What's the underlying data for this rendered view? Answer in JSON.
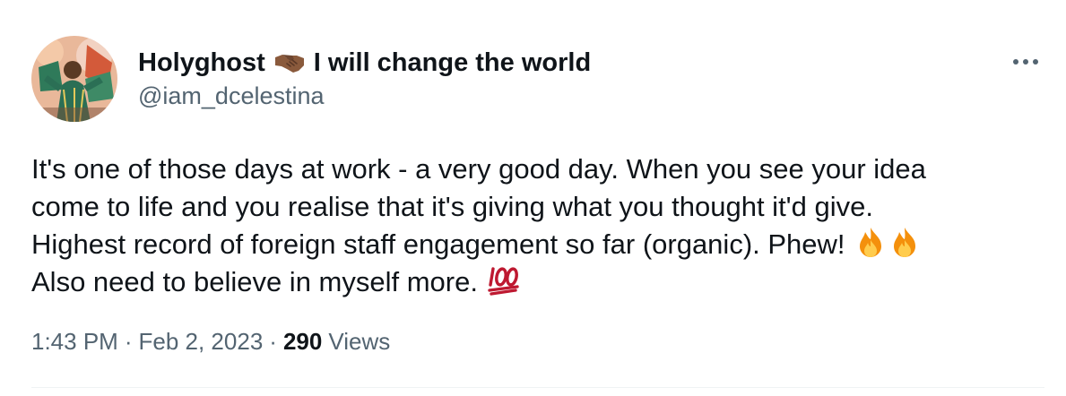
{
  "author": {
    "display_name": "Holyghost",
    "display_name_suffix": "I will change the world",
    "name_emoji": "handshake-icon",
    "handle": "@iam_dcelestina"
  },
  "tweet": {
    "lines": [
      "It's one of those days at work - a very good day. When you see your idea",
      "come to life and you realise that it's giving what you thought it'd give.",
      "Highest record of foreign staff engagement so far (organic). Phew!",
      "Also need to believe in myself more."
    ],
    "line3_emojis": [
      "fire-icon",
      "fire-icon"
    ],
    "line4_emoji": "hundred-points-icon"
  },
  "meta": {
    "time": "1:43 PM",
    "separator": "·",
    "date": "Feb 2, 2023",
    "views_count": "290",
    "views_label": "Views"
  },
  "colors": {
    "text_primary": "#0f1419",
    "text_secondary": "#536471",
    "divider": "#eff3f4"
  }
}
